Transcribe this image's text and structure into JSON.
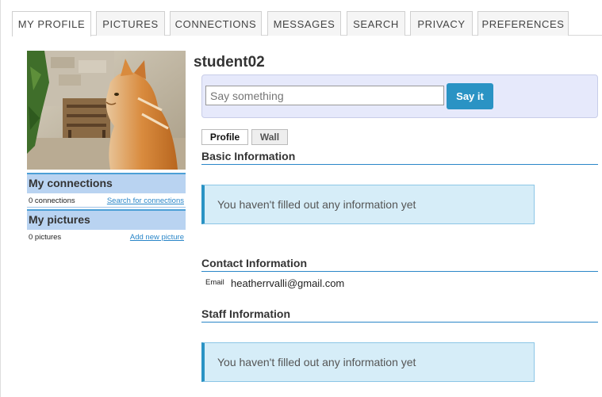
{
  "tabs": [
    {
      "label": "MY PROFILE",
      "active": true
    },
    {
      "label": "PICTURES",
      "active": false
    },
    {
      "label": "CONNECTIONS",
      "active": false
    },
    {
      "label": "MESSAGES",
      "active": false
    },
    {
      "label": "SEARCH",
      "active": false
    },
    {
      "label": "PRIVACY",
      "active": false
    },
    {
      "label": "PREFERENCES",
      "active": false
    }
  ],
  "sidebar": {
    "connections": {
      "title": "My connections",
      "count": "0 connections",
      "link": "Search for connections"
    },
    "pictures": {
      "title": "My pictures",
      "count": "0 pictures",
      "link": "Add new picture"
    }
  },
  "profile": {
    "username": "student02",
    "status": {
      "placeholder": "Say something",
      "button": "Say it"
    },
    "subtabs": [
      {
        "label": "Profile",
        "active": true
      },
      {
        "label": "Wall",
        "active": false
      }
    ],
    "sections": {
      "basic": {
        "title": "Basic Information",
        "message": "You haven't filled out any information yet"
      },
      "contact": {
        "title": "Contact Information",
        "email_label": "Email",
        "email_value": "heatherrvalli@gmail.com"
      },
      "staff": {
        "title": "Staff Information",
        "message": "You haven't filled out any information yet"
      }
    }
  },
  "colors": {
    "accent": "#2a93c4",
    "sidebar_header": "#b9d3f1",
    "status_box": "#e6e9fb",
    "info_box": "#d6edf8"
  }
}
